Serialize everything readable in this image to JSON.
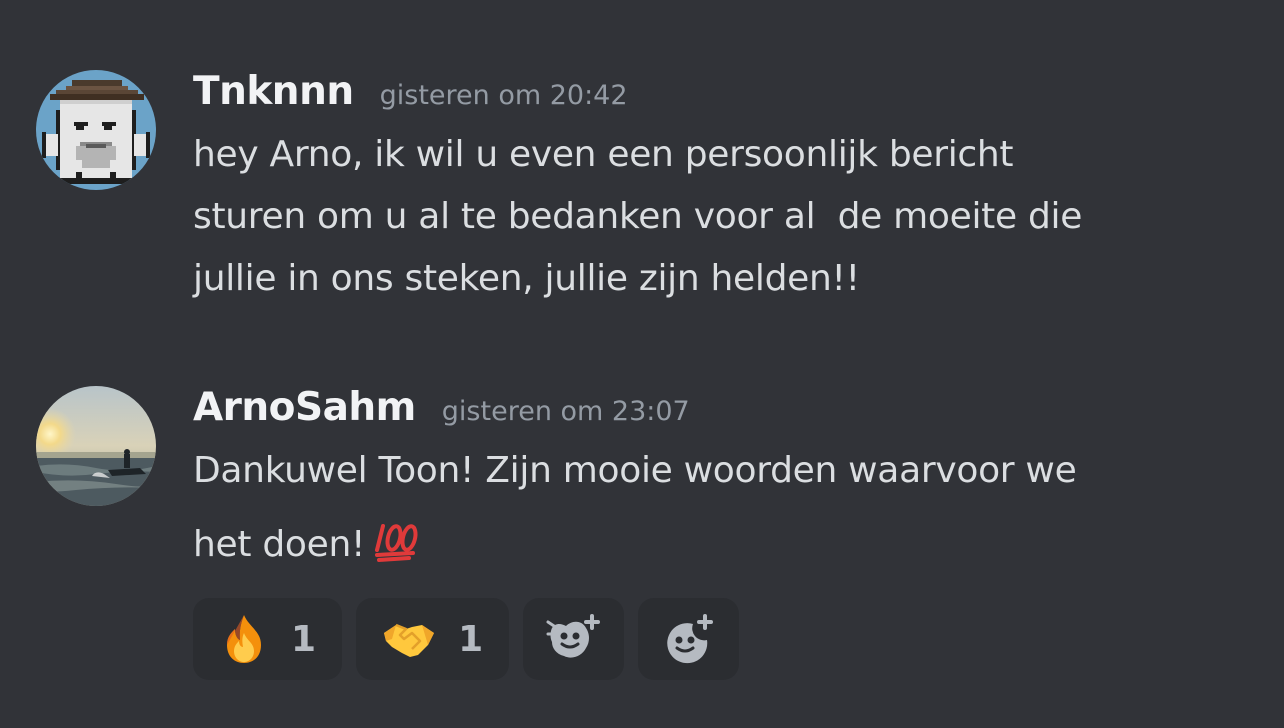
{
  "messages": [
    {
      "author": "Tnknnn",
      "timestamp": "gisteren om 20:42",
      "lines": [
        "hey Arno, ik wil u even een persoonlijk bericht",
        "sturen om u al te bedanken voor al  de moeite die",
        "jullie in ons steken, jullie zijn helden!!"
      ],
      "avatar_icon": "pixel-ghost-cowboy-hat"
    },
    {
      "author": "ArnoSahm",
      "timestamp": "gisteren om 23:07",
      "lines": [
        "Dankuwel Toon! Zijn mooie woorden waarvoor we",
        "het doen!"
      ],
      "inline_emoji": "hundred-points-icon",
      "avatar_icon": "jetski-sunset-photo",
      "reactions": [
        {
          "emoji": "fire-icon",
          "count": "1"
        },
        {
          "emoji": "handshake-icon",
          "count": "1"
        }
      ],
      "add_reaction_buttons": [
        "add-super-reaction-icon",
        "add-reaction-icon"
      ]
    }
  ],
  "colors": {
    "background": "#313338",
    "reaction_bg": "#2b2d31",
    "username": "#f2f3f5",
    "text": "#dbdee1",
    "timestamp": "#949ba4"
  }
}
